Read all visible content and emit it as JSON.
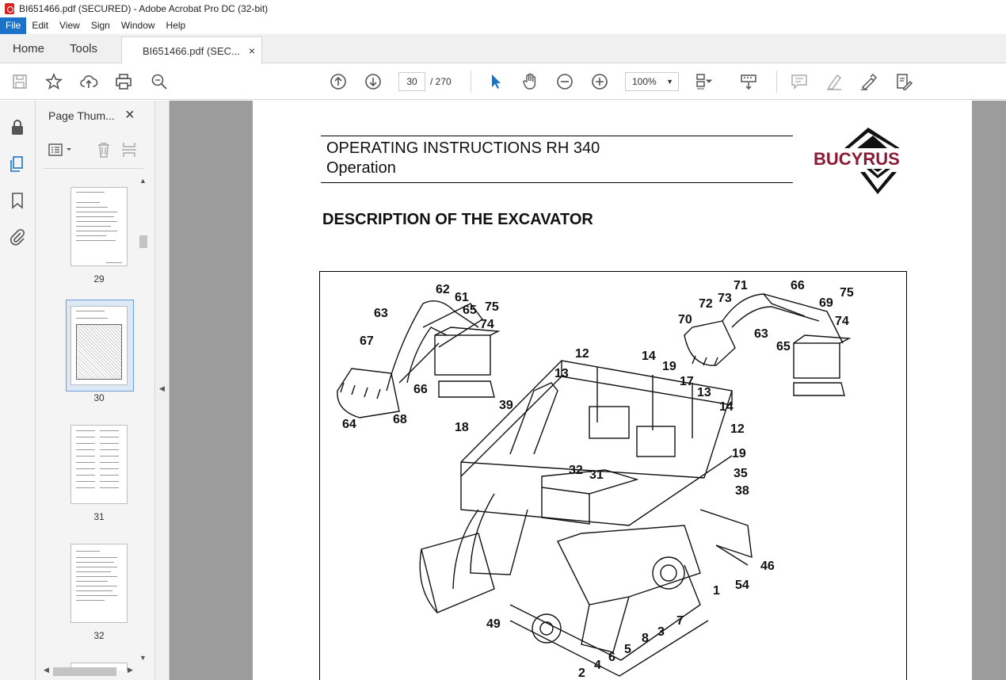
{
  "window": {
    "title": "BI651466.pdf (SECURED) - Adobe Acrobat Pro DC (32-bit)"
  },
  "menu": {
    "items": [
      "File",
      "Edit",
      "View",
      "Sign",
      "Window",
      "Help"
    ]
  },
  "tabs": {
    "home": "Home",
    "tools": "Tools",
    "document": "BI651466.pdf (SEC...",
    "close": "×"
  },
  "toolbar": {
    "page_current": "30",
    "page_total": "/ 270",
    "zoom": "100%"
  },
  "thumbnails": {
    "title": "Page Thum...",
    "close": "×",
    "pages": [
      "29",
      "30",
      "31",
      "32"
    ],
    "selected": "30"
  },
  "document": {
    "header_line1": "OPERATING INSTRUCTIONS RH 340",
    "header_line2": "Operation",
    "logo_text": "BUCYRUS",
    "section_title": "DESCRIPTION OF THE EXCAVATOR",
    "callouts": [
      "62",
      "61",
      "65",
      "75",
      "63",
      "74",
      "67",
      "66",
      "64",
      "68",
      "71",
      "66",
      "72",
      "73",
      "75",
      "70",
      "69",
      "63",
      "74",
      "65",
      "12",
      "14",
      "13",
      "19",
      "17",
      "13",
      "39",
      "14",
      "18",
      "12",
      "19",
      "32",
      "31",
      "35",
      "38",
      "46",
      "1",
      "54",
      "7",
      "3",
      "49",
      "8",
      "5",
      "6",
      "4",
      "2"
    ]
  },
  "colors": {
    "accent": "#1a73c8",
    "brand": "#8b1a38",
    "canvas": "#9c9c9c"
  }
}
